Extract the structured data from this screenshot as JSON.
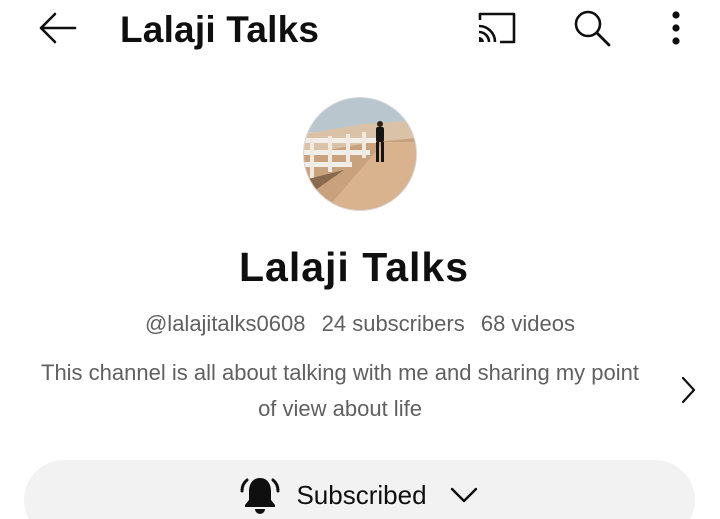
{
  "appbar": {
    "title": "Lalaji Talks",
    "icons": [
      "back-arrow-icon",
      "cast-icon",
      "search-icon",
      "more-vertical-icon"
    ]
  },
  "channel": {
    "name": "Lalaji Talks",
    "handle": "@lalajitalks0608",
    "subscribers": "24 subscribers",
    "videos": "68 videos",
    "description": "This channel is all about talking with me and sharing my point of view about life"
  },
  "subscribe": {
    "label": "Subscribed",
    "icons": [
      "bell-ringing-icon",
      "chevron-down-icon"
    ]
  },
  "colors": {
    "text_primary": "#0f0f0f",
    "text_secondary": "#606060",
    "button_bg": "#f2f2f2"
  }
}
